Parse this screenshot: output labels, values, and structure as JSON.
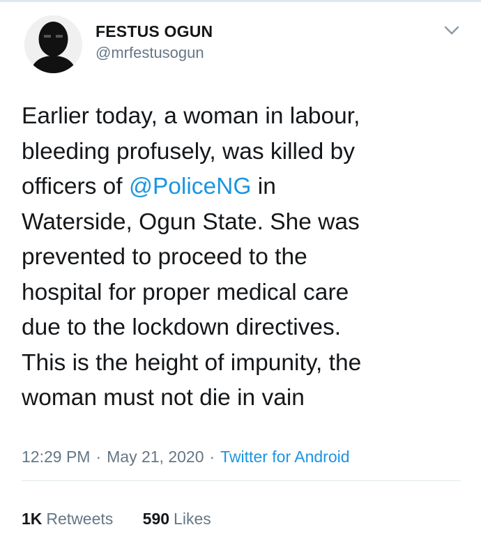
{
  "author": {
    "display_name": "FESTUS OGUN",
    "handle": "@mrfestusogun"
  },
  "icons": {
    "avatar": "avatar-image",
    "menu": "chevron-down-icon"
  },
  "tweet": {
    "lines": [
      {
        "text": "Earlier today, a woman in labour,"
      },
      {
        "text": "bleeding profusely, was killed by"
      },
      {
        "before": "officers of ",
        "mention": "@PoliceNG",
        "after": " in"
      },
      {
        "text": "Waterside, Ogun State. She was"
      },
      {
        "text": "prevented to proceed to the"
      },
      {
        "text": "hospital for proper medical care"
      },
      {
        "text": "due to the lockdown directives."
      },
      {
        "text": "This is the height of impunity, the"
      },
      {
        "text": "woman must not die in vain"
      }
    ]
  },
  "meta": {
    "time": "12:29 PM",
    "separator": "·",
    "date": "May 21, 2020",
    "source": "Twitter for Android"
  },
  "stats": {
    "retweets_count": "1K",
    "retweets_label": "Retweets",
    "likes_count": "590",
    "likes_label": "Likes"
  },
  "colors": {
    "link": "#1b95e0",
    "secondary_text": "#657786",
    "primary_text": "#14171a",
    "divider": "#e1e8ed"
  }
}
